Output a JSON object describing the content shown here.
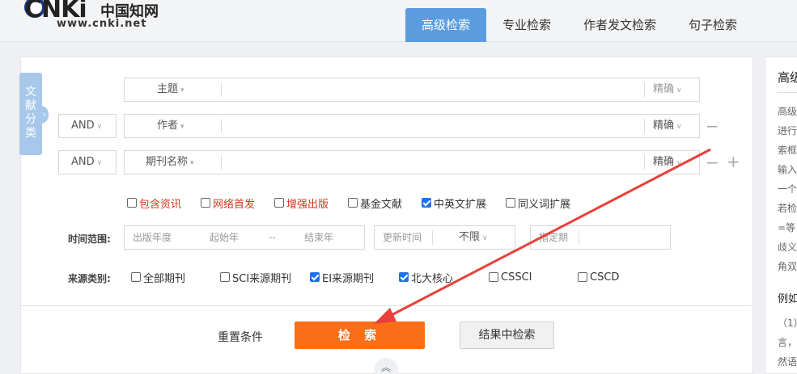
{
  "logo": {
    "brand": "CNKi",
    "brand_cn": "中国知网",
    "site": "www.cnki.net"
  },
  "tabs": [
    {
      "label": "高级检索",
      "active": true
    },
    {
      "label": "专业检索",
      "active": false
    },
    {
      "label": "作者发文检索",
      "active": false
    },
    {
      "label": "句子检索",
      "active": false
    }
  ],
  "classify": {
    "chars": [
      "文",
      "献",
      "分",
      "类"
    ],
    "knob": "›"
  },
  "rows": [
    {
      "logic": "",
      "field": "主题",
      "value": "",
      "match": "精确"
    },
    {
      "logic": "AND",
      "field": "作者",
      "value": "",
      "match": "精确"
    },
    {
      "logic": "AND",
      "field": "期刊名称",
      "value": "",
      "match": "精确"
    }
  ],
  "icons": {
    "caret": "▾",
    "chevron": "∨",
    "minus": "−",
    "plus": "+",
    "collapse": "︽"
  },
  "options": [
    {
      "label": "包含资讯",
      "checked": false,
      "red": true
    },
    {
      "label": "网络首发",
      "checked": false,
      "red": true
    },
    {
      "label": "增强出版",
      "checked": false,
      "red": true
    },
    {
      "label": "基金文献",
      "checked": false,
      "red": false
    },
    {
      "label": "中英文扩展",
      "checked": true,
      "red": false
    },
    {
      "label": "同义词扩展",
      "checked": false,
      "red": false
    }
  ],
  "time": {
    "label": "时间范围:",
    "pub_year": "出版年度",
    "start_year": "起始年",
    "dash": "--",
    "end_year": "结束年",
    "update_label": "更新时间",
    "update_value": "不限",
    "specify": "指定期"
  },
  "source": {
    "label": "来源类别:",
    "items": [
      {
        "label": "全部期刊",
        "checked": false
      },
      {
        "label": "SCI来源期刊",
        "checked": false
      },
      {
        "label": "EI来源期刊",
        "checked": true
      },
      {
        "label": "北大核心",
        "checked": true
      },
      {
        "label": "CSSCI",
        "checked": false
      },
      {
        "label": "CSCD",
        "checked": false
      }
    ]
  },
  "actions": {
    "reset": "重置条件",
    "search": "检 索",
    "result_search": "结果中检索"
  },
  "side": {
    "title": "高级",
    "lines": [
      "高级",
      "进行",
      "索框",
      "输入",
      "一个",
      "若检",
      "=等",
      "歧义",
      "角双"
    ],
    "example": "例如",
    "ex_lines": [
      "（1）",
      "言，",
      "然语"
    ]
  },
  "colors": {
    "tab_active": "#5b9cdf",
    "search_button": "#fa6d19",
    "checkbox_on": "#1a73e8",
    "red_option": "#d8351f",
    "arrow": "#e8413b",
    "classify_tab": "#a7c8ea"
  }
}
